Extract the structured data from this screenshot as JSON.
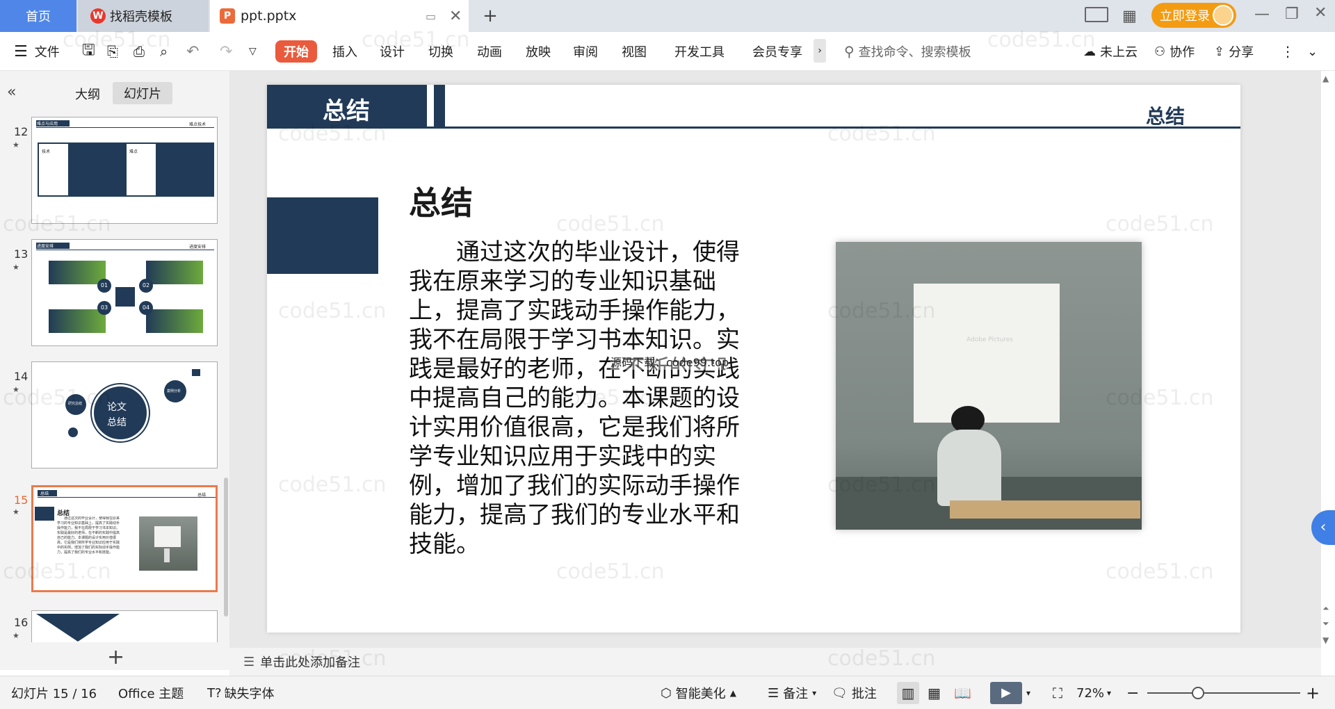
{
  "tabs": {
    "home": "首页",
    "docer": "找稻壳模板",
    "file": "ppt.pptx",
    "add": "+"
  },
  "account": {
    "login": "立即登录"
  },
  "toolbar": {
    "file_menu": "文件",
    "tabs": [
      "开始",
      "插入",
      "设计",
      "切换",
      "动画",
      "放映",
      "审阅",
      "视图",
      "开发工具",
      "会员专享"
    ],
    "search_placeholder": "查找命令、搜索模板",
    "cloud": "未上云",
    "collab": "协作",
    "share": "分享"
  },
  "panel": {
    "tabs": [
      "大纲",
      "幻灯片"
    ],
    "slide_numbers": [
      "12",
      "13",
      "14",
      "15",
      "16"
    ],
    "thumb12": {
      "header": "难点与应用",
      "right": "难点技术",
      "box1": "技术",
      "box2": "难点"
    },
    "thumb13": {
      "header": "进度安排",
      "right": "进度安排",
      "nums": [
        "01",
        "02",
        "03",
        "04"
      ]
    },
    "thumb14": {
      "center1": "论文",
      "center2": "总结",
      "left": "研究总结",
      "right": "案例分析"
    },
    "thumb15": {
      "header": "总结",
      "right": "总结",
      "title": "总结"
    }
  },
  "slide": {
    "header_title": "总结",
    "header_right": "总结",
    "title": "总结",
    "body": "　　通过这次的毕业设计，使得我在原来学习的专业知识基础上，提高了实践动手操作能力，我不在局限于学习书本知识。实践是最好的老师，在不断的实践中提高自己的能力。本课题的设计实用价值很高，它是我们将所学专业知识应用于实践中的实例，增加了我们的实际动手操作能力，提高了我们的专业水平和技能。",
    "overlay_text": "源码下载：code99.top",
    "image_screen_text": "Adobe Pictures",
    "watermark": "code51.cn"
  },
  "notes_placeholder": "单击此处添加备注",
  "status": {
    "slide_count": "幻灯片 15 / 16",
    "theme": "Office 主题",
    "missing_font": "缺失字体",
    "beautify": "智能美化",
    "notes": "备注",
    "comments": "批注",
    "zoom": "72%"
  },
  "colors": {
    "accent": "#ea5a3c",
    "navy": "#213a57",
    "tab_blue": "#4f86e8",
    "login": "#f39c12",
    "selected_thumb": "#ea7a4c"
  }
}
